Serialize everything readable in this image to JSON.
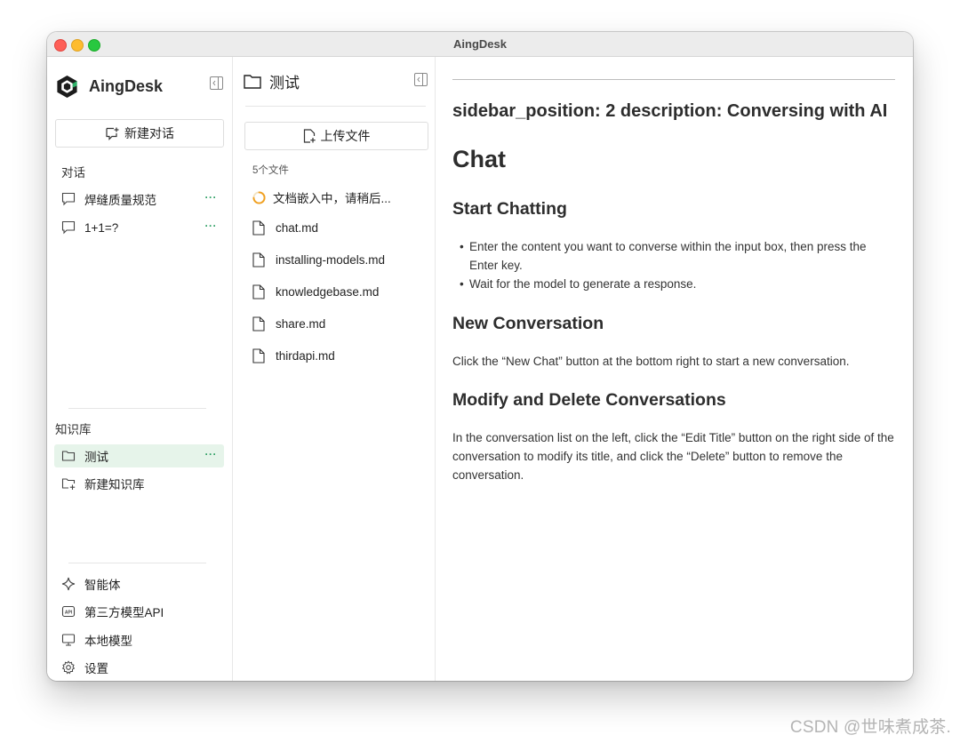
{
  "window": {
    "title": "AingDesk"
  },
  "sidebar": {
    "brand_name": "AingDesk",
    "new_chat_label": "新建对话",
    "conversations_label": "对话",
    "conversations": [
      {
        "title": "焊缝质量规范",
        "more": "···"
      },
      {
        "title": "1+1=?",
        "more": "···"
      }
    ],
    "knowledge_label": "知识库",
    "knowledge_bases": [
      {
        "title": "测试",
        "more": "···",
        "active": true
      }
    ],
    "new_kb_label": "新建知识库",
    "bottom_nav": [
      {
        "label": "智能体",
        "icon": "sparkle-icon"
      },
      {
        "label": "第三方模型API",
        "icon": "api-icon"
      },
      {
        "label": "本地模型",
        "icon": "monitor-icon"
      },
      {
        "label": "设置",
        "icon": "gear-icon"
      }
    ]
  },
  "file_panel": {
    "title": "测试",
    "upload_label": "上传文件",
    "file_count": "5个文件",
    "embedding_status": "文档嵌入中，请稍后...",
    "files": [
      "chat.md",
      "installing-models.md",
      "knowledgebase.md",
      "share.md",
      "thirdapi.md"
    ]
  },
  "content": {
    "meta_heading": "sidebar_position: 2 description: Conversing with AI",
    "h1": "Chat",
    "sections": [
      {
        "heading": "Start Chatting",
        "bullets": [
          "Enter the content you want to converse within the input box, then press the Enter key.",
          "Wait for the model to generate a response."
        ]
      },
      {
        "heading": "New Conversation",
        "paragraph": "Click the “New Chat” button at the bottom right to start a new conversation."
      },
      {
        "heading": "Modify and Delete Conversations",
        "paragraph": "In the conversation list on the left, click the “Edit Title” button on the right side of the conversation to modify its title, and click the “Delete” button to remove the conversation."
      }
    ]
  },
  "watermark": "CSDN @世味煮成茶.",
  "colors": {
    "accent": "#2fa065",
    "active_bg": "#e6f4ea",
    "spinner": "#f0a020"
  }
}
